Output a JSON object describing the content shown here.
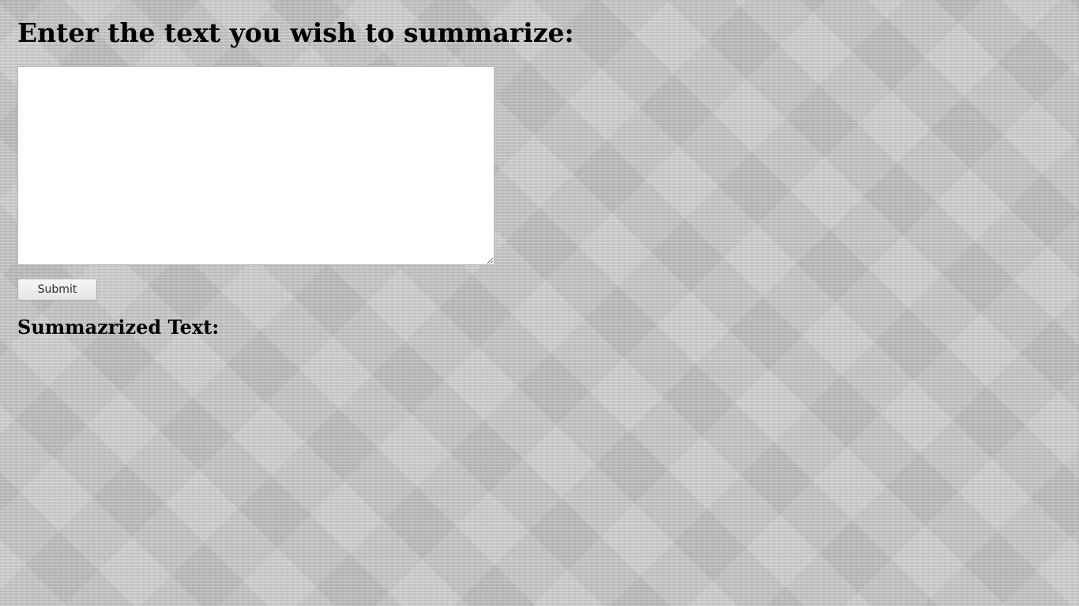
{
  "form": {
    "heading": "Enter the text you wish to summarize:",
    "textarea_value": "",
    "submit_label": "Submit"
  },
  "result": {
    "heading": "Summazrized Text:",
    "output": ""
  }
}
